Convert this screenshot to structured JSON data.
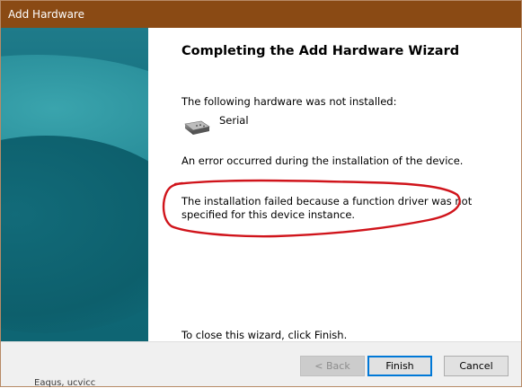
{
  "window": {
    "title": "Add Hardware"
  },
  "wizard": {
    "heading": "Completing the Add Hardware Wizard",
    "not_installed_label": "The following hardware was not installed:",
    "device_name": "Serial",
    "device_icon": "serial-device-icon",
    "error_message": "An error occurred during the installation of the device.",
    "failure_reason_line1": "The installation failed because a function driver was not",
    "failure_reason_line2": "specified for this device instance.",
    "close_instruction": "To close this wizard, click Finish."
  },
  "buttons": {
    "back_label": "< Back",
    "finish_label": "Finish",
    "cancel_label": "Cancel"
  },
  "background": {
    "partial_text": "Eaqus, ucvicc"
  },
  "colors": {
    "titlebar": "#8a4a14",
    "banner": "#0f6a78",
    "annotation": "#d0141b",
    "default_button_border": "#0078d7"
  }
}
